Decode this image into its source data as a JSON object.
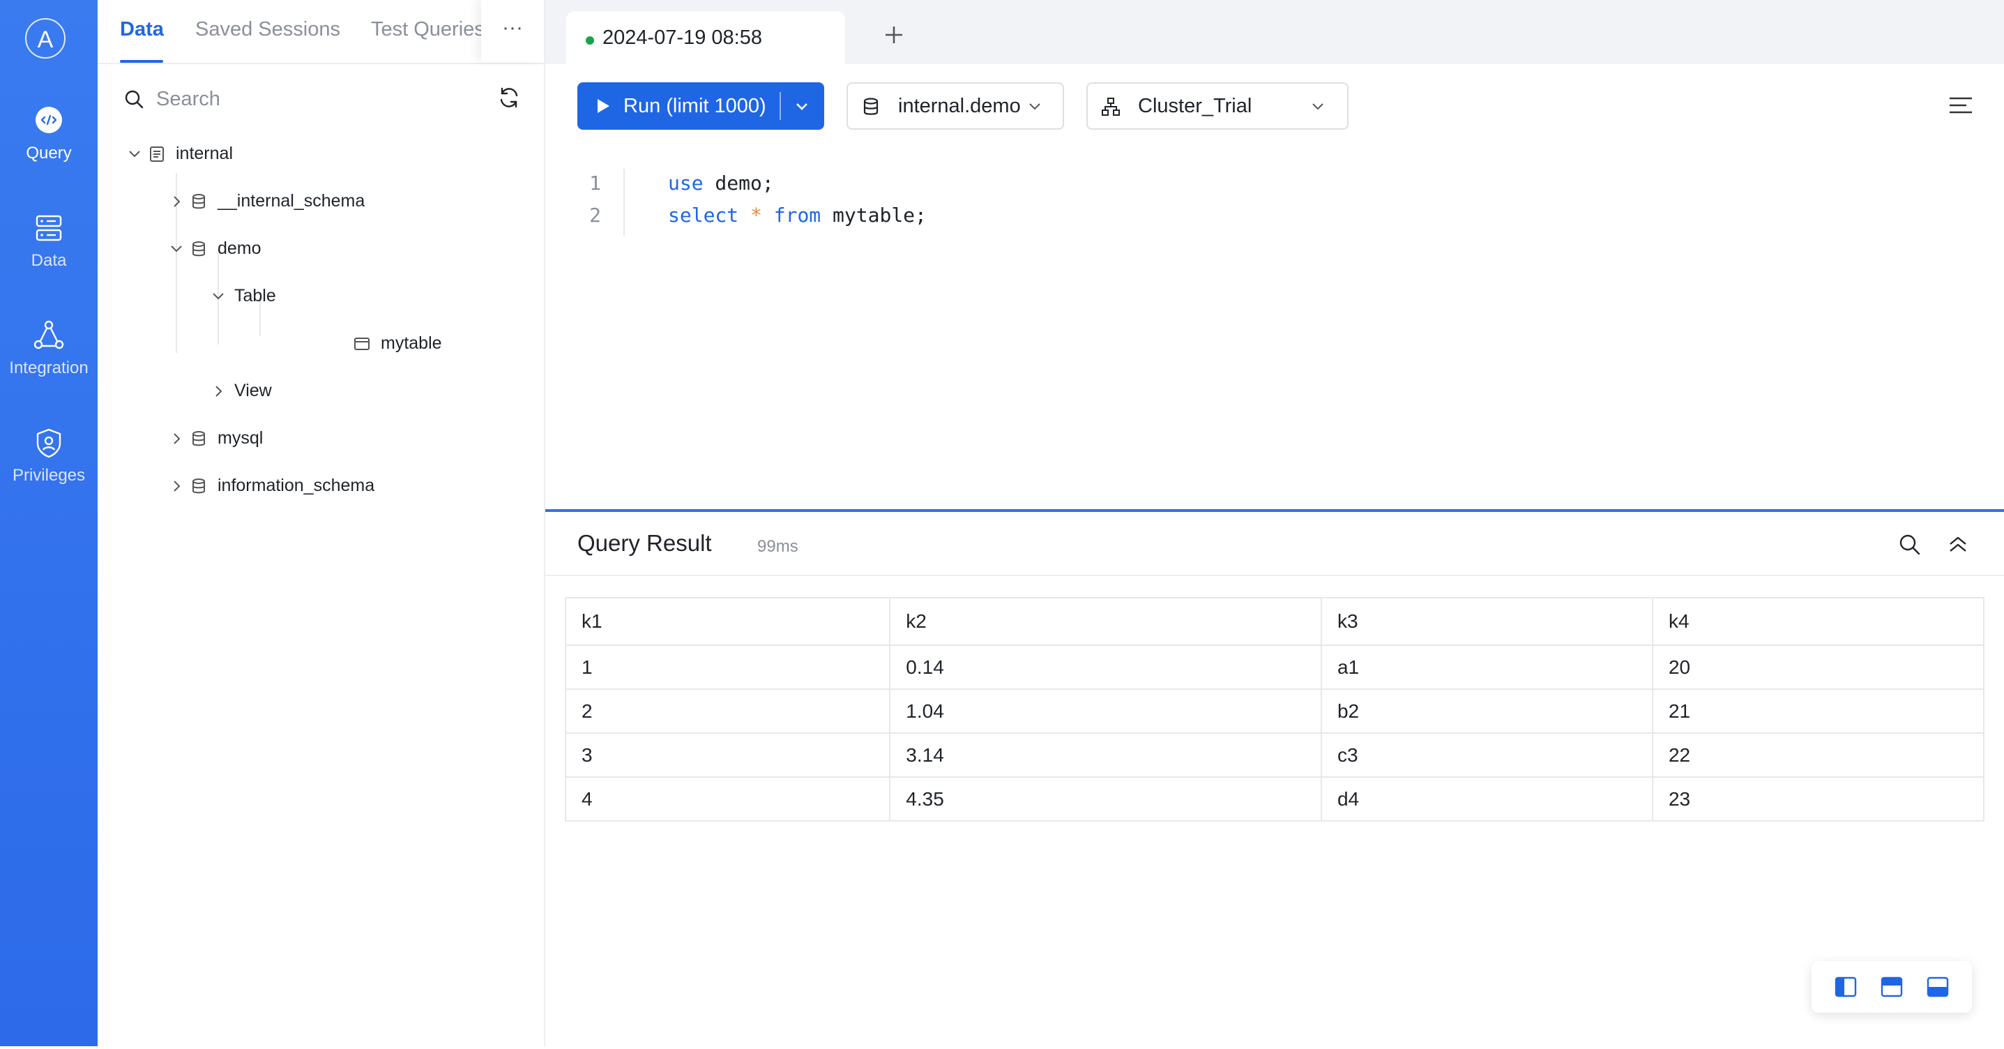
{
  "nav": {
    "avatar_letter": "A",
    "items": [
      {
        "label": "Query",
        "icon": "code-query-icon",
        "active": true
      },
      {
        "label": "Data",
        "icon": "server-icon",
        "active": false
      },
      {
        "label": "Integration",
        "icon": "integration-icon",
        "active": false
      },
      {
        "label": "Privileges",
        "icon": "shield-user-icon",
        "active": false
      }
    ]
  },
  "sidebar": {
    "tabs": [
      {
        "label": "Data",
        "active": true
      },
      {
        "label": "Saved Sessions",
        "active": false
      },
      {
        "label": "Test Queries",
        "active": false
      }
    ],
    "more_label": "···",
    "search": {
      "placeholder": "Search",
      "value": ""
    },
    "tree": [
      {
        "label": "internal",
        "icon": "catalog-icon",
        "expanded": true,
        "level": 0
      },
      {
        "label": "__internal_schema",
        "icon": "database-icon",
        "expanded": false,
        "level": 1
      },
      {
        "label": "demo",
        "icon": "database-icon",
        "expanded": true,
        "level": 1
      },
      {
        "label": "Table",
        "icon": "",
        "expanded": true,
        "level": 2
      },
      {
        "label": "mytable",
        "icon": "table-icon",
        "expanded": false,
        "level": 3
      },
      {
        "label": "View",
        "icon": "",
        "expanded": false,
        "level": 2
      },
      {
        "label": "mysql",
        "icon": "database-icon",
        "expanded": false,
        "level": 1
      },
      {
        "label": "information_schema",
        "icon": "database-icon",
        "expanded": false,
        "level": 1
      }
    ]
  },
  "session_tab": {
    "label": "2024-07-19 08:58",
    "status_color": "#1aa34a"
  },
  "toolbar": {
    "run_label": "Run (limit 1000)",
    "database_select": "internal.demo",
    "cluster_select": "Cluster_Trial"
  },
  "editor": {
    "lines": [
      {
        "number": "1",
        "tokens": [
          {
            "t": "use",
            "k": "kw"
          },
          {
            "t": " demo;",
            "k": ""
          }
        ]
      },
      {
        "number": "2",
        "tokens": [
          {
            "t": "select",
            "k": "kw"
          },
          {
            "t": " ",
            "k": ""
          },
          {
            "t": "*",
            "k": "op"
          },
          {
            "t": " ",
            "k": ""
          },
          {
            "t": "from",
            "k": "kw"
          },
          {
            "t": " mytable;",
            "k": ""
          }
        ]
      }
    ]
  },
  "result": {
    "title": "Query Result",
    "elapsed": "99ms",
    "columns": [
      "k1",
      "k2",
      "k3",
      "k4"
    ],
    "rows": [
      [
        "1",
        "0.14",
        "a1",
        "20"
      ],
      [
        "2",
        "1.04",
        "b2",
        "21"
      ],
      [
        "3",
        "3.14",
        "c3",
        "22"
      ],
      [
        "4",
        "4.35",
        "d4",
        "23"
      ]
    ]
  },
  "colors": {
    "accent": "#1f66e5",
    "rail": "#3a7bf0",
    "keyword": "#1f66e5",
    "operator": "#e8873a"
  }
}
